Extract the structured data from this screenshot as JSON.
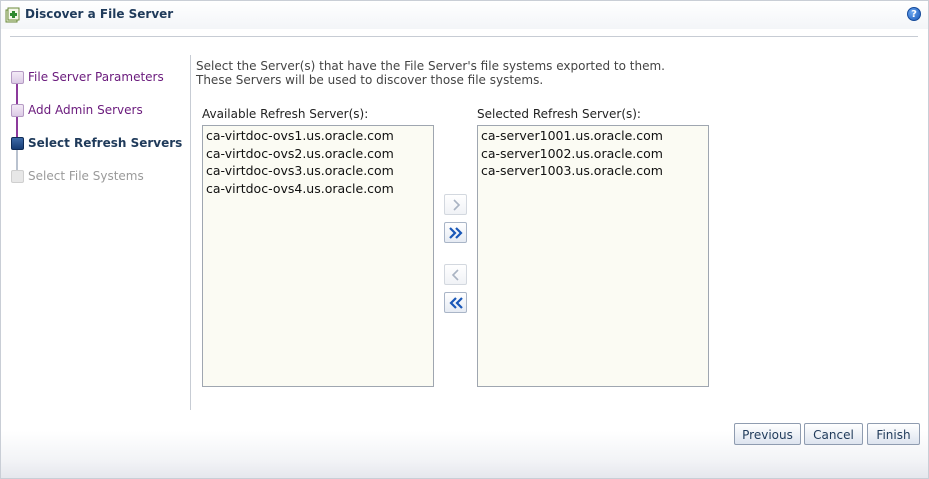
{
  "dialog": {
    "title": "Discover a File Server",
    "help_icon": "help-icon",
    "help_glyph": "?"
  },
  "steps": [
    {
      "label": "File Server Parameters",
      "state": "visited"
    },
    {
      "label": "Add Admin Servers",
      "state": "visited"
    },
    {
      "label": "Select Refresh Servers",
      "state": "current"
    },
    {
      "label": "Select File Systems",
      "state": "disabled"
    }
  ],
  "instructions": {
    "line1": "Select the Server(s) that have the File Server's file systems exported to them.",
    "line2": "These Servers will be used to discover those file systems."
  },
  "available": {
    "label": "Available Refresh Server(s):",
    "items": [
      "ca-virtdoc-ovs1.us.oracle.com",
      "ca-virtdoc-ovs2.us.oracle.com",
      "ca-virtdoc-ovs3.us.oracle.com",
      "ca-virtdoc-ovs4.us.oracle.com"
    ]
  },
  "selected": {
    "label": "Selected Refresh Server(s):",
    "items": [
      "ca-server1001.us.oracle.com",
      "ca-server1002.us.oracle.com",
      "ca-server1003.us.oracle.com"
    ]
  },
  "shuttle": {
    "move_icon": "chevron-right-icon",
    "move_all_icon": "double-chevron-right-icon",
    "remove_icon": "chevron-left-icon",
    "remove_all_icon": "double-chevron-left-icon"
  },
  "buttons": {
    "previous": {
      "pre": "Previ",
      "u": "o",
      "post": "us"
    },
    "cancel": {
      "pre": "",
      "u": "C",
      "post": "ancel"
    },
    "finish": {
      "pre": "",
      "u": "F",
      "post": "inish"
    }
  },
  "colors": {
    "visited_step": "#6a1a7c",
    "current_step": "#1f3a5a",
    "disabled_step": "#9a9a9a",
    "listbox_bg": "#fbfbf3",
    "accent_blue": "#1a58b8"
  }
}
